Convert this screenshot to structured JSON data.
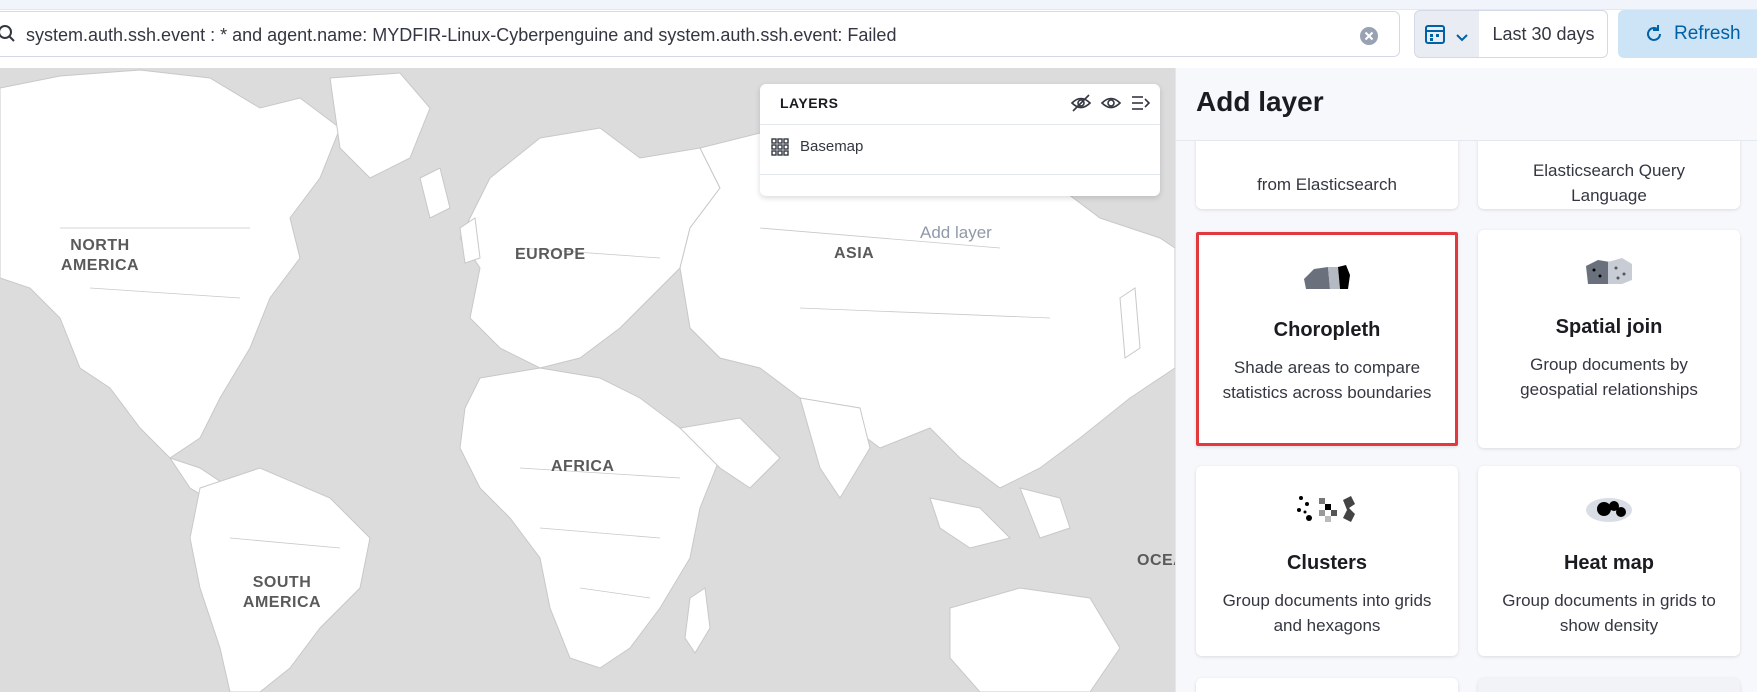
{
  "query": {
    "text": "system.auth.ssh.event : * and agent.name: MYDFIR-Linux-Cyberpenguine and system.auth.ssh.event: Failed"
  },
  "date_picker": {
    "label": "Last 30 days",
    "icon": "calendar-icon"
  },
  "refresh": {
    "label": "Refresh",
    "icon": "refresh-icon"
  },
  "map": {
    "labels": {
      "north_america": "NORTH\nAMERICA",
      "europe": "EUROPE",
      "asia": "ASIA",
      "africa": "AFRICA",
      "south_america": "SOUTH\nAMERICA",
      "oceania": "OCEA"
    },
    "ghost_label": "Add layer"
  },
  "layers_panel": {
    "title": "LAYERS",
    "icons": [
      "eye-closed-icon",
      "eye-icon",
      "collapse-menu-icon"
    ],
    "layers": [
      {
        "name": "Basemap",
        "icon": "grid-icon"
      }
    ]
  },
  "add_layer": {
    "title": "Add layer",
    "partial_cards": [
      {
        "desc": "from Elasticsearch"
      },
      {
        "desc": "Elasticsearch Query Language"
      }
    ],
    "cards": [
      {
        "title": "Choropleth",
        "desc": "Shade areas to compare statistics across boundaries",
        "selected": true,
        "icon": "choropleth-icon"
      },
      {
        "title": "Spatial join",
        "desc": "Group documents by geospatial relationships",
        "selected": false,
        "icon": "spatial-join-icon"
      },
      {
        "title": "Clusters",
        "desc": "Group documents into grids and hexagons",
        "selected": false,
        "icon": "clusters-icon"
      },
      {
        "title": "Heat map",
        "desc": "Group documents in grids to show density",
        "selected": false,
        "icon": "heatmap-icon"
      }
    ]
  },
  "colors": {
    "accent": "#0061a6",
    "selected_border": "#e0393e",
    "map_water": "#dcdcdc",
    "map_land": "#ffffff"
  }
}
